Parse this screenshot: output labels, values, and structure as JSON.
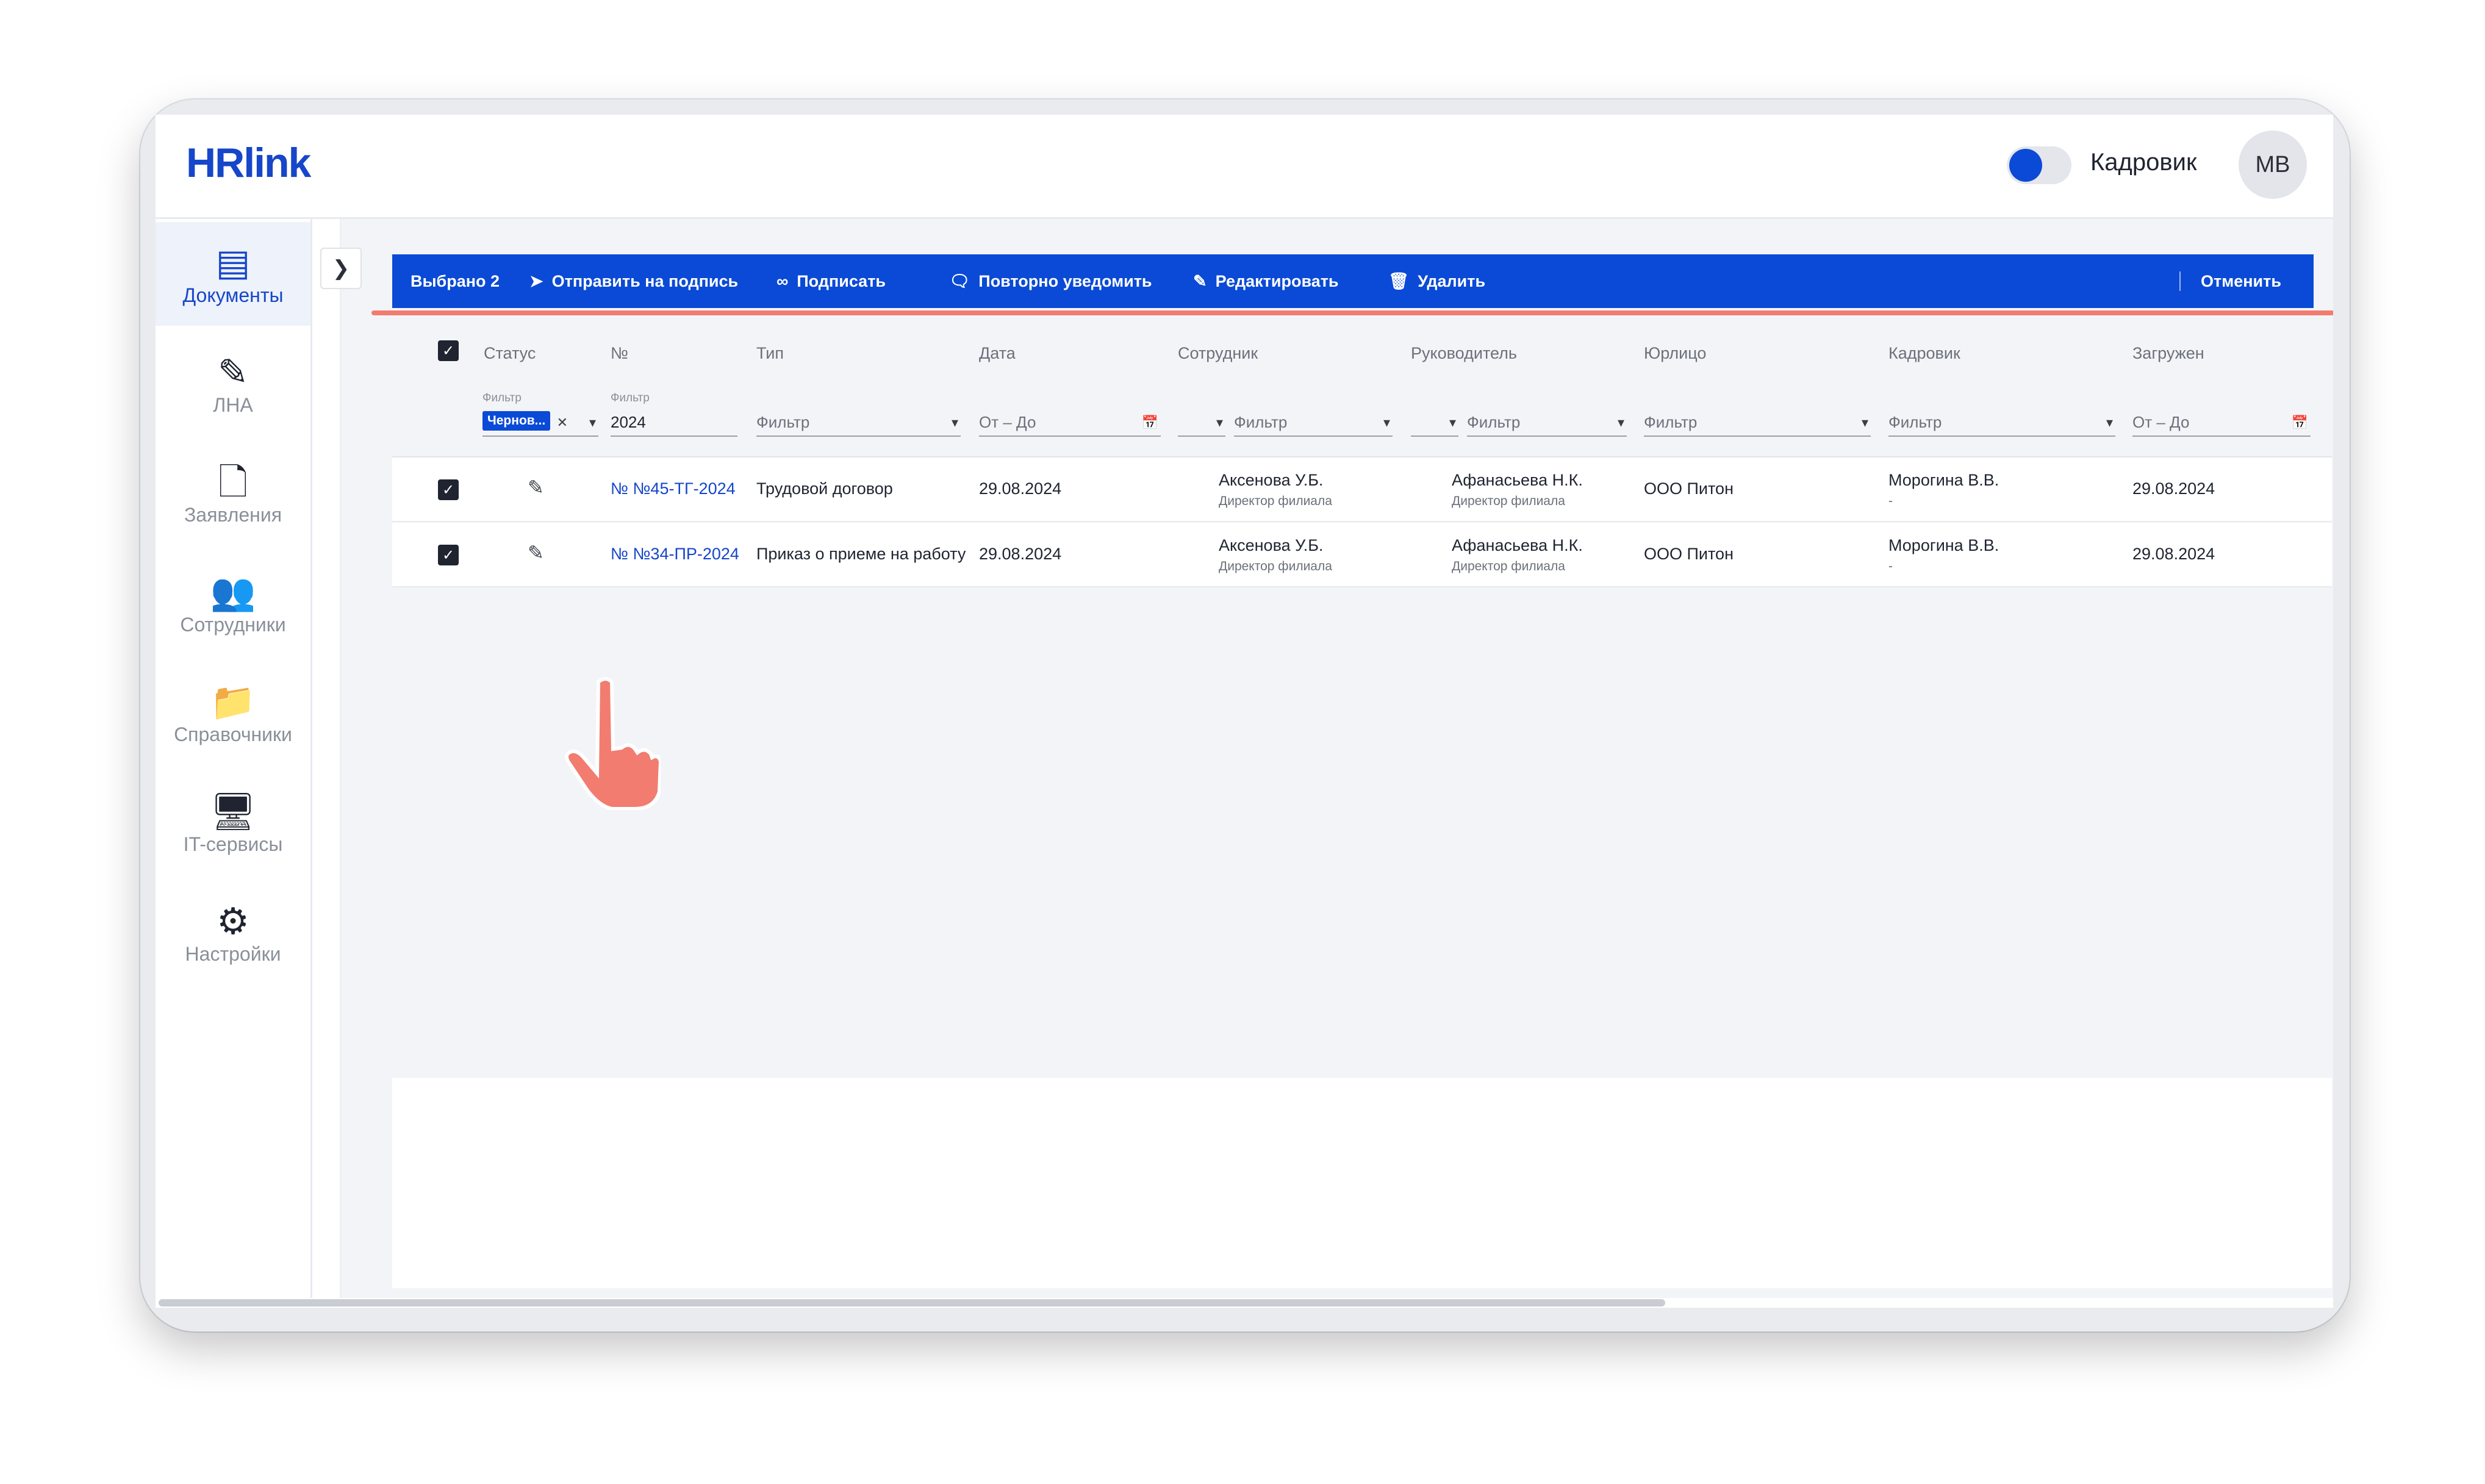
{
  "header": {
    "logo": "HRlink",
    "role_label": "Кадровик",
    "avatar_initials": "МВ",
    "role_toggle_on": true
  },
  "sidebar": {
    "items": [
      {
        "label": "Документы",
        "icon": "documents-icon",
        "active": true
      },
      {
        "label": "ЛНА",
        "icon": "lna-icon",
        "active": false
      },
      {
        "label": "Заявления",
        "icon": "applications-icon",
        "active": false
      },
      {
        "label": "Сотрудники",
        "icon": "employees-icon",
        "active": false
      },
      {
        "label": "Справочники",
        "icon": "directories-icon",
        "active": false
      },
      {
        "label": "IT-сервисы",
        "icon": "it-services-icon",
        "active": false
      },
      {
        "label": "Настройки",
        "icon": "settings-icon",
        "active": false
      }
    ],
    "help_label": "?"
  },
  "actionbar": {
    "selected": "Выбрано 2",
    "send": "Отправить на подпись",
    "sign": "Подписать",
    "notify": "Повторно уведомить",
    "edit": "Редактировать",
    "delete": "Удалить",
    "cancel": "Отменить",
    "bg_color": "#0a4ad6"
  },
  "table": {
    "columns": [
      "Статус",
      "№",
      "Тип",
      "Дата",
      "Сотрудник",
      "Руководитель",
      "Юрлицо",
      "Кадровик",
      "Загружен"
    ],
    "filters": {
      "status_label": "Фильтр",
      "status_chip": "Чернов...",
      "number_label": "Фильтр",
      "number_value": "2024",
      "type": "Фильтр",
      "date": "От – До",
      "employee": "Фильтр",
      "manager": "Фильтр",
      "legal": "Фильтр",
      "hr": "Фильтр",
      "uploaded": "От – До"
    },
    "rows": [
      {
        "checked": true,
        "number": "№ №45-ТГ-2024",
        "type": "Трудовой договор",
        "date": "29.08.2024",
        "employee": "Аксенова У.Б.",
        "employee_role": "Директор филиала",
        "manager": "Афанасьева Н.К.",
        "manager_role": "Директор филиала",
        "legal": "ООО Питон",
        "hr": "Морогина В.В.",
        "hr_sub": "-",
        "uploaded": "29.08.2024"
      },
      {
        "checked": true,
        "number": "№ №34-ПР-2024",
        "type": "Приказ о приеме на работу",
        "date": "29.08.2024",
        "employee": "Аксенова У.Б.",
        "employee_role": "Директор филиала",
        "manager": "Афанасьева Н.К.",
        "manager_role": "Директор филиала",
        "legal": "ООО Питон",
        "hr": "Морогина В.В.",
        "hr_sub": "-",
        "uploaded": "29.08.2024"
      }
    ]
  }
}
